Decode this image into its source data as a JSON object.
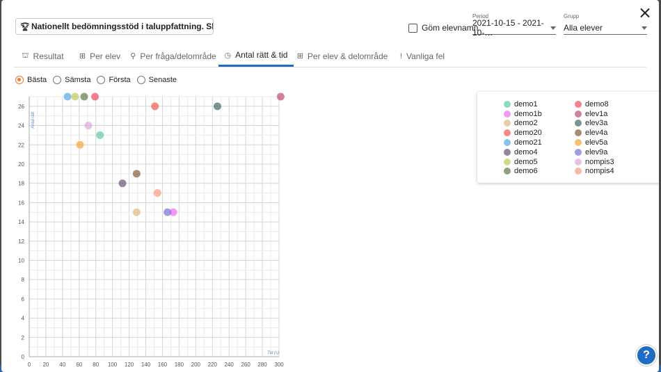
{
  "header": {
    "test_title": "Nationellt bedömningsstöd i taluppfattning. Skriftli…",
    "hide_names_label": "Göm elevnamn"
  },
  "period": {
    "label": "Period",
    "value": "2021-10-15 - 2021-10-…"
  },
  "group": {
    "label": "Grupp",
    "value": "Alla elever"
  },
  "tabs": [
    {
      "label": "Resultat",
      "icon": "chart-icon"
    },
    {
      "label": "Per elev",
      "icon": "people-icon"
    },
    {
      "label": "Per fråga/delområde",
      "icon": "person-question-icon"
    },
    {
      "label": "Antal rätt & tid",
      "icon": "clock-icon",
      "active": true
    },
    {
      "label": "Per elev & delområde",
      "icon": "grid-icon"
    },
    {
      "label": "Vanliga fel",
      "icon": "exclamation-icon"
    }
  ],
  "radios": [
    {
      "label": "Bästa",
      "selected": true
    },
    {
      "label": "Sämsta"
    },
    {
      "label": "Första"
    },
    {
      "label": "Senaste"
    }
  ],
  "help_label": "?",
  "chart_data": {
    "type": "scatter",
    "xlabel": "Tid (s)",
    "ylabel": "Antal rätt",
    "xlim": [
      0,
      300
    ],
    "ylim": [
      0,
      27
    ],
    "xticks": [
      0,
      20,
      40,
      60,
      80,
      100,
      120,
      140,
      160,
      180,
      200,
      220,
      240,
      260,
      280,
      300
    ],
    "yticks": [
      0,
      2,
      4,
      6,
      8,
      10,
      12,
      14,
      16,
      18,
      20,
      22,
      24,
      26
    ],
    "grid": true,
    "legend_position": "right",
    "series": [
      {
        "name": "demo1",
        "color": "#5fc7a6",
        "points": [
          [
            85,
            23
          ]
        ]
      },
      {
        "name": "demo1b",
        "color": "#f06cf0",
        "points": [
          [
            173,
            15
          ]
        ]
      },
      {
        "name": "demo2",
        "color": "#e0b87e",
        "points": [
          [
            129,
            15
          ]
        ]
      },
      {
        "name": "demo20",
        "color": "#ef5a50",
        "points": [
          [
            151,
            26
          ]
        ]
      },
      {
        "name": "demo21",
        "color": "#55aae6",
        "points": [
          [
            46,
            27
          ]
        ]
      },
      {
        "name": "demo4",
        "color": "#6a5478",
        "points": [
          [
            112,
            18
          ]
        ]
      },
      {
        "name": "demo5",
        "color": "#c2c75a",
        "points": [
          [
            55,
            27
          ]
        ]
      },
      {
        "name": "demo6",
        "color": "#5f7a4a",
        "points": [
          [
            66,
            27
          ]
        ]
      },
      {
        "name": "demo8",
        "color": "#f04a5e",
        "points": [
          [
            79,
            27
          ]
        ]
      },
      {
        "name": "elev1a",
        "color": "#c04a78",
        "points": [
          [
            302,
            27
          ]
        ]
      },
      {
        "name": "elev3a",
        "color": "#3f6a6a",
        "points": [
          [
            226,
            26
          ]
        ]
      },
      {
        "name": "elev4a",
        "color": "#8a5a3a",
        "points": [
          [
            129,
            19
          ]
        ]
      },
      {
        "name": "elev5a",
        "color": "#f8a638",
        "points": [
          [
            61,
            22
          ]
        ]
      },
      {
        "name": "elev9a",
        "color": "#7a72d2",
        "points": [
          [
            166,
            15
          ]
        ]
      },
      {
        "name": "nompis3",
        "color": "#dcaadc",
        "points": [
          [
            71,
            24
          ]
        ]
      },
      {
        "name": "nompis4",
        "color": "#f89a80",
        "points": [
          [
            154,
            17
          ]
        ]
      }
    ]
  }
}
